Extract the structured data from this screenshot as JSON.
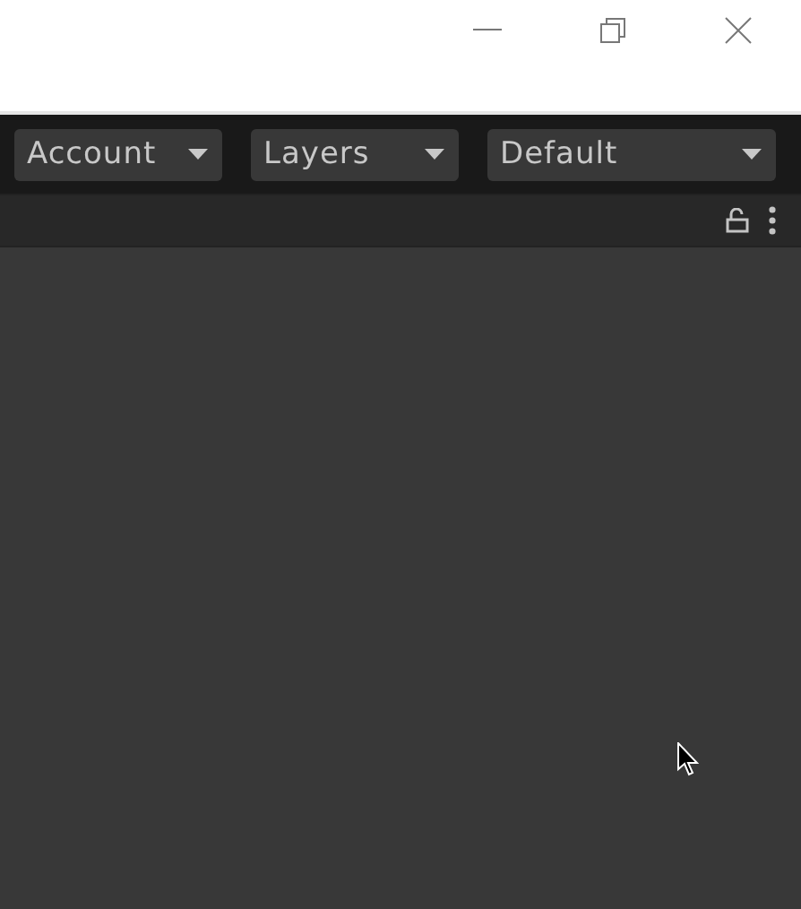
{
  "toolbar": {
    "dropdowns": [
      {
        "label": "Account",
        "kind": "narrow"
      },
      {
        "label": "Layers",
        "kind": "narrow"
      },
      {
        "label": "Default",
        "kind": "wide"
      }
    ]
  }
}
